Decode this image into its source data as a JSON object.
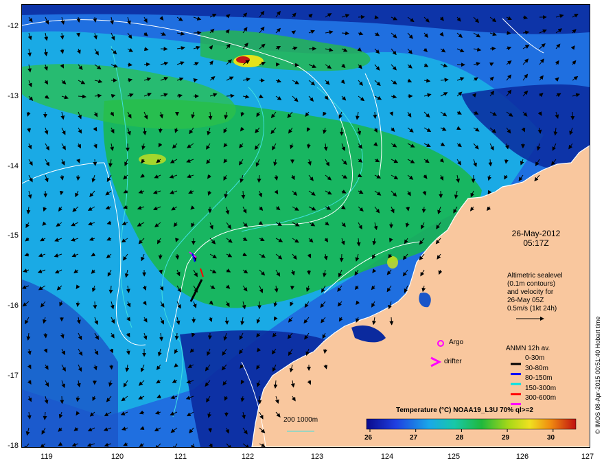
{
  "map": {
    "lat_ticks": [
      "-12",
      "-13",
      "-14",
      "-15",
      "-16",
      "-17",
      "-18"
    ],
    "lon_ticks": [
      "119",
      "120",
      "121",
      "122",
      "123",
      "124",
      "125",
      "126",
      "127"
    ],
    "colors": {
      "ocean_deep": "#0b2a9e",
      "ocean_mid": "#1f6fe0",
      "ocean_light": "#1ab0e6",
      "warm_green": "#19b84a",
      "yellow": "#e5e21a",
      "land": "#f9c79e",
      "contour": "#ffffff",
      "isobath": "#40e0e0"
    }
  },
  "timestamp": {
    "date": "26-May-2012",
    "time": "05:17Z"
  },
  "altimetry_note": {
    "line1": "Altimetric sealevel",
    "line2": "(0.1m contours)",
    "line3": "and velocity for",
    "line4": "26-May 05Z",
    "line5": "0.5m/s (1kt 24h)"
  },
  "markers": {
    "argo_label": "Argo",
    "drifter_label": "drifter"
  },
  "anmn": {
    "title": "ANMN 12h av.",
    "items": [
      {
        "label": "0-30m",
        "color": "#000000"
      },
      {
        "label": "30-80m",
        "color": "#0000ff"
      },
      {
        "label": "80-150m",
        "color": "#00e5e5"
      },
      {
        "label": "150-300m",
        "color": "#ff0000"
      },
      {
        "label": "300-600m",
        "color": "#ff00ff"
      }
    ]
  },
  "isobath_label": "200  1000m",
  "colorbar": {
    "title": "Temperature (°C) NOAA19_L3U 70% ql>=2",
    "ticks": [
      "26",
      "27",
      "28",
      "29",
      "30"
    ]
  },
  "credit": "© IMOS 08-Apr-2015 00:51:40 Hobart time"
}
